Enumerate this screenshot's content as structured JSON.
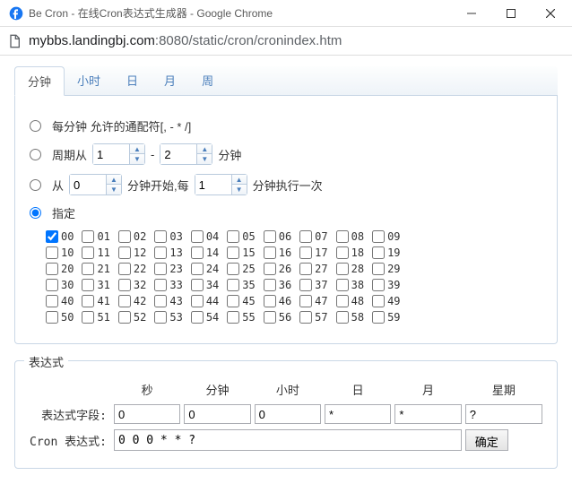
{
  "window": {
    "title": "Be Cron - 在线Cron表达式生成器 - Google Chrome"
  },
  "address": {
    "host": "mybbs.landingbj.com",
    "port": ":8080",
    "path": "/static/cron/cronindex.htm"
  },
  "tabs": [
    "分钟",
    "小时",
    "日",
    "月",
    "周"
  ],
  "active_tab": 0,
  "options": {
    "every": {
      "label": "每分钟 允许的通配符[, - * /]"
    },
    "cycle": {
      "prefix": "周期从",
      "dash": "-",
      "suffix": "分钟",
      "from": "1",
      "to": "2"
    },
    "start": {
      "prefix": "从",
      "mid": "分钟开始,每",
      "suffix": "分钟执行一次",
      "from": "0",
      "every": "1"
    },
    "specify": {
      "label": "指定"
    }
  },
  "selected_option": "specify",
  "minutes": {
    "checked": [
      "00"
    ],
    "rows": [
      [
        "00",
        "01",
        "02",
        "03",
        "04",
        "05",
        "06",
        "07",
        "08",
        "09"
      ],
      [
        "10",
        "11",
        "12",
        "13",
        "14",
        "15",
        "16",
        "17",
        "18",
        "19"
      ],
      [
        "20",
        "21",
        "22",
        "23",
        "24",
        "25",
        "26",
        "27",
        "28",
        "29"
      ],
      [
        "30",
        "31",
        "32",
        "33",
        "34",
        "35",
        "36",
        "37",
        "38",
        "39"
      ],
      [
        "40",
        "41",
        "42",
        "43",
        "44",
        "45",
        "46",
        "47",
        "48",
        "49"
      ],
      [
        "50",
        "51",
        "52",
        "53",
        "54",
        "55",
        "56",
        "57",
        "58",
        "59"
      ]
    ]
  },
  "expression": {
    "legend": "表达式",
    "headers": [
      "秒",
      "分钟",
      "小时",
      "日",
      "月",
      "星期"
    ],
    "field_label": "表达式字段:",
    "fields": {
      "sec": "0",
      "min": "0",
      "hour": "0",
      "day": "*",
      "month": "*",
      "week": "?"
    },
    "cron_label": "Cron 表达式:",
    "cron_value": "0 0 0 * * ?",
    "ok": "确定"
  }
}
